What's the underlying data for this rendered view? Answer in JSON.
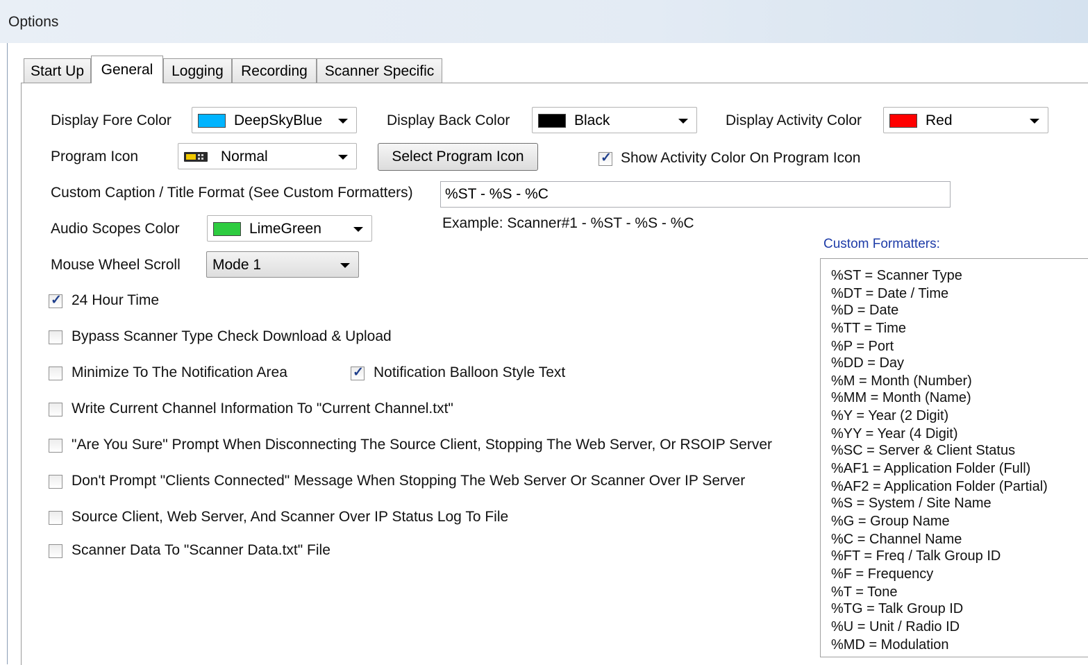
{
  "window": {
    "title": "Options"
  },
  "tabs": [
    {
      "label": "Start Up"
    },
    {
      "label": "General"
    },
    {
      "label": "Logging"
    },
    {
      "label": "Recording"
    },
    {
      "label": "Scanner Specific"
    }
  ],
  "colors": {
    "display_fore": "#00b4ff",
    "display_back": "#000000",
    "display_activity": "#ff0000",
    "audio_scopes": "#2ecc40"
  },
  "general": {
    "display_fore": {
      "label": "Display Fore Color",
      "value": "DeepSkyBlue"
    },
    "display_back": {
      "label": "Display Back Color",
      "value": "Black"
    },
    "display_activity": {
      "label": "Display Activity Color",
      "value": "Red"
    },
    "program_icon": {
      "label": "Program Icon",
      "value": "Normal",
      "icon": "radio-scanner-icon"
    },
    "select_icon_button": "Select Program Icon",
    "show_activity_color": {
      "label": "Show Activity Color On Program Icon",
      "checked": true
    },
    "caption_format": {
      "label": "Custom Caption / Title Format (See Custom Formatters)",
      "value": "%ST - %S - %C",
      "example": "Example:  Scanner#1 - %ST - %S - %C"
    },
    "audio_scopes": {
      "label": "Audio Scopes Color",
      "value": "LimeGreen"
    },
    "mouse_wheel": {
      "label": "Mouse Wheel Scroll",
      "value": "Mode 1"
    },
    "checkboxes": [
      {
        "label": "24 Hour Time",
        "checked": true
      },
      {
        "label": "Bypass Scanner Type Check Download & Upload",
        "checked": false
      },
      {
        "label": "Minimize To The Notification Area",
        "checked": false
      },
      {
        "label": "Notification Balloon Style Text",
        "checked": true
      },
      {
        "label": "Write Current Channel Information To \"Current Channel.txt\"",
        "checked": false
      },
      {
        "label": "\"Are You Sure\" Prompt When Disconnecting The Source Client, Stopping The Web Server, Or RSOIP Server",
        "checked": false
      },
      {
        "label": "Don't Prompt \"Clients Connected\" Message When Stopping The Web Server Or Scanner Over IP Server",
        "checked": false
      },
      {
        "label": "Source Client, Web Server, And Scanner Over IP Status Log To File",
        "checked": false
      },
      {
        "label": "Scanner Data To \"Scanner Data.txt\" File",
        "checked": false
      }
    ]
  },
  "formatters": {
    "title": "Custom Formatters:",
    "items": [
      "%ST = Scanner Type",
      "%DT = Date / Time",
      "%D = Date",
      "%TT = Time",
      "%P = Port",
      "%DD = Day",
      "%M = Month (Number)",
      "%MM = Month (Name)",
      "%Y = Year (2 Digit)",
      "%YY = Year (4 Digit)",
      "%SC = Server & Client Status",
      "%AF1 = Application Folder (Full)",
      "%AF2 = Application Folder (Partial)",
      "%S = System / Site Name",
      "%G = Group Name",
      "%C = Channel Name",
      "%FT = Freq / Talk Group ID",
      "%F = Frequency",
      "%T = Tone",
      "%TG = Talk Group ID",
      "%U = Unit / Radio ID",
      "%MD = Modulation"
    ]
  }
}
